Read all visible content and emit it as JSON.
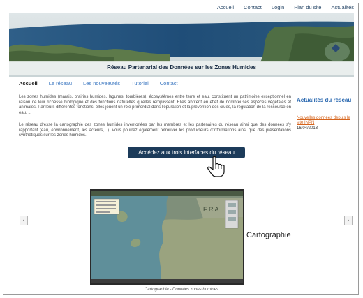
{
  "toplinks": [
    "Accueil",
    "Contact",
    "Login",
    "Plan du site",
    "Actualités"
  ],
  "banner": {
    "title": "Réseau Partenarial des Données sur les Zones Humides"
  },
  "nav": [
    {
      "label": "Accueil",
      "active": true
    },
    {
      "label": "Le réseau",
      "active": false
    },
    {
      "label": "Les nouveautés",
      "active": false
    },
    {
      "label": "Tutoriel",
      "active": false
    },
    {
      "label": "Contact",
      "active": false
    }
  ],
  "intro": {
    "p1": "Les zones humides (marais, prairies humides, lagunes, tourbières), écosystèmes entre terre et eau, constituent un patrimoine exceptionnel en raison de leur richesse biologique et des fonctions naturelles qu'elles remplissent. Elles abritent en effet de nombreuses espèces végétales et animales. Par leurs différentes fonctions, elles jouent un rôle primordial dans l'épuration et la prévention des crues, la régulation de la ressource en eau, ...",
    "p2": "Le réseau dresse la cartographie des zones humides inventoriées par les membres et les partenaires du réseau ainsi que des données s'y rapportant (eau, environnement, les acteurs,...). Vous pourrez également retrouver les producteurs d'informations ainsi que des présentations synthétiques sur les zones humides."
  },
  "sidebar": {
    "title": "Actualités du réseau",
    "news_link": "Nouvelles données depuis le site INPN",
    "news_date": "16/04/2013"
  },
  "cta": {
    "label": "Accédez aux trois interfaces du réseau"
  },
  "slideshow": {
    "prev": "‹",
    "next": "›",
    "slide_label": "Cartographie",
    "map_text": "F R A",
    "caption": "Cartographie - Données zones humides"
  },
  "colors": {
    "nav_link": "#3a76c0",
    "sidebar_title": "#2b69b0",
    "news_link": "#d6641c",
    "cta_bg": "#1c3b5a"
  }
}
